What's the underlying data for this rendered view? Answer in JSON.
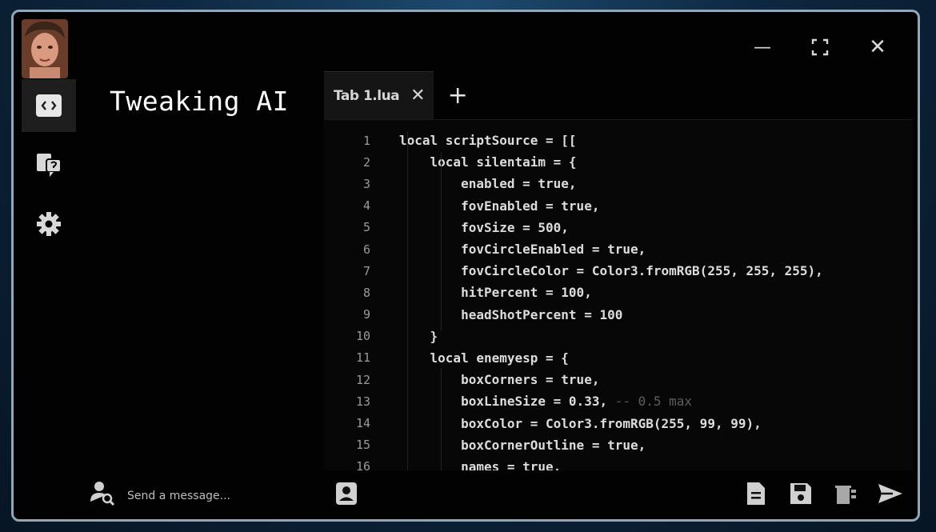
{
  "app": {
    "title": "Tweaking AI"
  },
  "window_controls": {
    "minimize": "—",
    "maximize": "⛶",
    "close": "✕"
  },
  "sidebar": {
    "items": [
      {
        "icon": "code-editor-icon",
        "active": true
      },
      {
        "icon": "chat-bubbles-icon",
        "active": false
      },
      {
        "icon": "gear-icon",
        "active": false
      }
    ]
  },
  "editor": {
    "tabs": [
      {
        "label": "Tab 1.lua",
        "close": "✕"
      }
    ],
    "add_tab": "+",
    "lines": [
      {
        "n": "1",
        "text": "local scriptSource = [["
      },
      {
        "n": "2",
        "text": "    local silentaim = {"
      },
      {
        "n": "3",
        "text": "        enabled = true,"
      },
      {
        "n": "4",
        "text": "        fovEnabled = true,"
      },
      {
        "n": "5",
        "text": "        fovSize = 500,"
      },
      {
        "n": "6",
        "text": "        fovCircleEnabled = true,"
      },
      {
        "n": "7",
        "text": "        fovCircleColor = Color3.fromRGB(255, 255, 255),"
      },
      {
        "n": "8",
        "text": "        hitPercent = 100,"
      },
      {
        "n": "9",
        "text": "        headShotPercent = 100"
      },
      {
        "n": "10",
        "text": "    }"
      },
      {
        "n": "11",
        "text": "    local enemyesp = {"
      },
      {
        "n": "12",
        "text": "        boxCorners = true,"
      },
      {
        "n": "13",
        "text": "        boxLineSize = 0.33,",
        "comment": " -- 0.5 max"
      },
      {
        "n": "14",
        "text": "        boxColor = Color3.fromRGB(255, 99, 99),"
      },
      {
        "n": "15",
        "text": "        boxCornerOutline = true,"
      },
      {
        "n": "16",
        "text": "        names = true,"
      }
    ]
  },
  "chat": {
    "placeholder": "Send a message..."
  },
  "colors": {
    "window_bg": "#020202",
    "border": "#8fa7b7",
    "text": "#dcdcdc"
  }
}
